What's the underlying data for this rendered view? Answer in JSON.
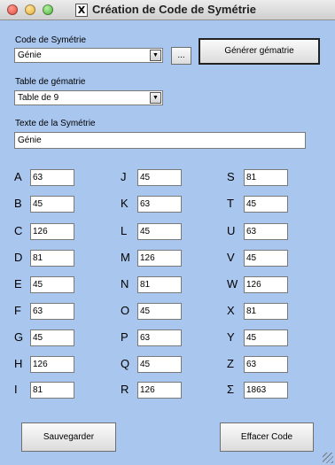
{
  "window": {
    "title": "Création de Code de Symétrie",
    "app_icon": "X"
  },
  "code": {
    "label": "Code de Symétrie",
    "value": "Génie",
    "browse_label": "...",
    "generate_label": "Générer gématrie"
  },
  "table": {
    "label": "Table de gématrie",
    "value": "Table de 9"
  },
  "text": {
    "label": "Texte de la Symétrie",
    "value": "Génie"
  },
  "letters": {
    "col1": [
      {
        "letter": "A",
        "value": "63"
      },
      {
        "letter": "B",
        "value": "45"
      },
      {
        "letter": "C",
        "value": "126"
      },
      {
        "letter": "D",
        "value": "81"
      },
      {
        "letter": "E",
        "value": "45"
      },
      {
        "letter": "F",
        "value": "63"
      },
      {
        "letter": "G",
        "value": "45"
      },
      {
        "letter": "H",
        "value": "126"
      },
      {
        "letter": "I",
        "value": "81"
      }
    ],
    "col2": [
      {
        "letter": "J",
        "value": "45"
      },
      {
        "letter": "K",
        "value": "63"
      },
      {
        "letter": "L",
        "value": "45"
      },
      {
        "letter": "M",
        "value": "126"
      },
      {
        "letter": "N",
        "value": "81"
      },
      {
        "letter": "O",
        "value": "45"
      },
      {
        "letter": "P",
        "value": "63"
      },
      {
        "letter": "Q",
        "value": "45"
      },
      {
        "letter": "R",
        "value": "126"
      }
    ],
    "col3": [
      {
        "letter": "S",
        "value": "81"
      },
      {
        "letter": "T",
        "value": "45"
      },
      {
        "letter": "U",
        "value": "63"
      },
      {
        "letter": "V",
        "value": "45"
      },
      {
        "letter": "W",
        "value": "126"
      },
      {
        "letter": "X",
        "value": "81"
      },
      {
        "letter": "Y",
        "value": "45"
      },
      {
        "letter": "Z",
        "value": "63"
      },
      {
        "letter": "Σ",
        "value": "1863"
      }
    ]
  },
  "footer": {
    "save_label": "Sauvegarder",
    "clear_label": "Effacer Code"
  },
  "icons": {
    "combo_arrow": "chevron-down-icon",
    "resize": "resize-grip-icon"
  }
}
